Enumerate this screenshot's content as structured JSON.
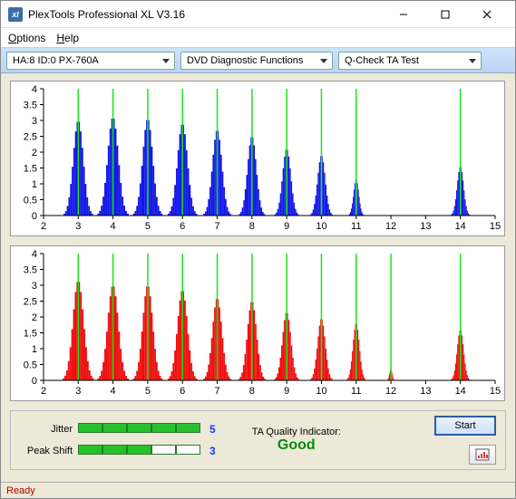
{
  "window": {
    "title": "PlexTools Professional XL V3.16"
  },
  "menu": {
    "options": "Options",
    "help": "Help"
  },
  "toolbar": {
    "drive": "HA:8 ID:0   PX-760A",
    "func": "DVD Diagnostic Functions",
    "test": "Q-Check TA Test"
  },
  "chart_data": [
    {
      "type": "bar",
      "color": "#1216e8",
      "xmin": 2,
      "xmax": 15,
      "ymin": 0,
      "ymax": 4,
      "xticks": [
        2,
        3,
        4,
        5,
        6,
        7,
        8,
        9,
        10,
        11,
        12,
        13,
        14,
        15
      ],
      "yticks": [
        0,
        0.5,
        1,
        1.5,
        2,
        2.5,
        3,
        3.5,
        4
      ],
      "peaks": [
        {
          "center": 3,
          "height": 3.0,
          "width": 0.85
        },
        {
          "center": 4,
          "height": 3.1,
          "width": 0.9
        },
        {
          "center": 5,
          "height": 3.05,
          "width": 0.85
        },
        {
          "center": 6,
          "height": 2.9,
          "width": 0.85
        },
        {
          "center": 7,
          "height": 2.7,
          "width": 0.8
        },
        {
          "center": 8,
          "height": 2.5,
          "width": 0.75
        },
        {
          "center": 9,
          "height": 2.1,
          "width": 0.7
        },
        {
          "center": 10,
          "height": 1.9,
          "width": 0.65
        },
        {
          "center": 11,
          "height": 1.15,
          "width": 0.45
        },
        {
          "center": 14,
          "height": 1.55,
          "width": 0.55
        }
      ]
    },
    {
      "type": "bar",
      "color": "#ef0e0e",
      "xmin": 2,
      "xmax": 15,
      "ymin": 0,
      "ymax": 4,
      "xticks": [
        2,
        3,
        4,
        5,
        6,
        7,
        8,
        9,
        10,
        11,
        12,
        13,
        14,
        15
      ],
      "yticks": [
        0,
        0.5,
        1,
        1.5,
        2,
        2.5,
        3,
        3.5,
        4
      ],
      "peaks": [
        {
          "center": 3,
          "height": 3.15,
          "width": 0.9
        },
        {
          "center": 4,
          "height": 3.0,
          "width": 0.9
        },
        {
          "center": 5,
          "height": 3.0,
          "width": 0.85
        },
        {
          "center": 6,
          "height": 2.85,
          "width": 0.85
        },
        {
          "center": 7,
          "height": 2.6,
          "width": 0.8
        },
        {
          "center": 8,
          "height": 2.5,
          "width": 0.78
        },
        {
          "center": 9,
          "height": 2.15,
          "width": 0.72
        },
        {
          "center": 10,
          "height": 1.95,
          "width": 0.65
        },
        {
          "center": 11,
          "height": 1.8,
          "width": 0.55
        },
        {
          "center": 12,
          "height": 0.35,
          "width": 0.25
        },
        {
          "center": 14,
          "height": 1.6,
          "width": 0.55
        }
      ]
    }
  ],
  "metrics": {
    "jitter": {
      "label": "Jitter",
      "value": 5,
      "max": 5
    },
    "peakshift": {
      "label": "Peak Shift",
      "value": 3,
      "max": 5
    }
  },
  "quality": {
    "label": "TA Quality Indicator:",
    "value": "Good"
  },
  "buttons": {
    "start": "Start"
  },
  "status": "Ready"
}
